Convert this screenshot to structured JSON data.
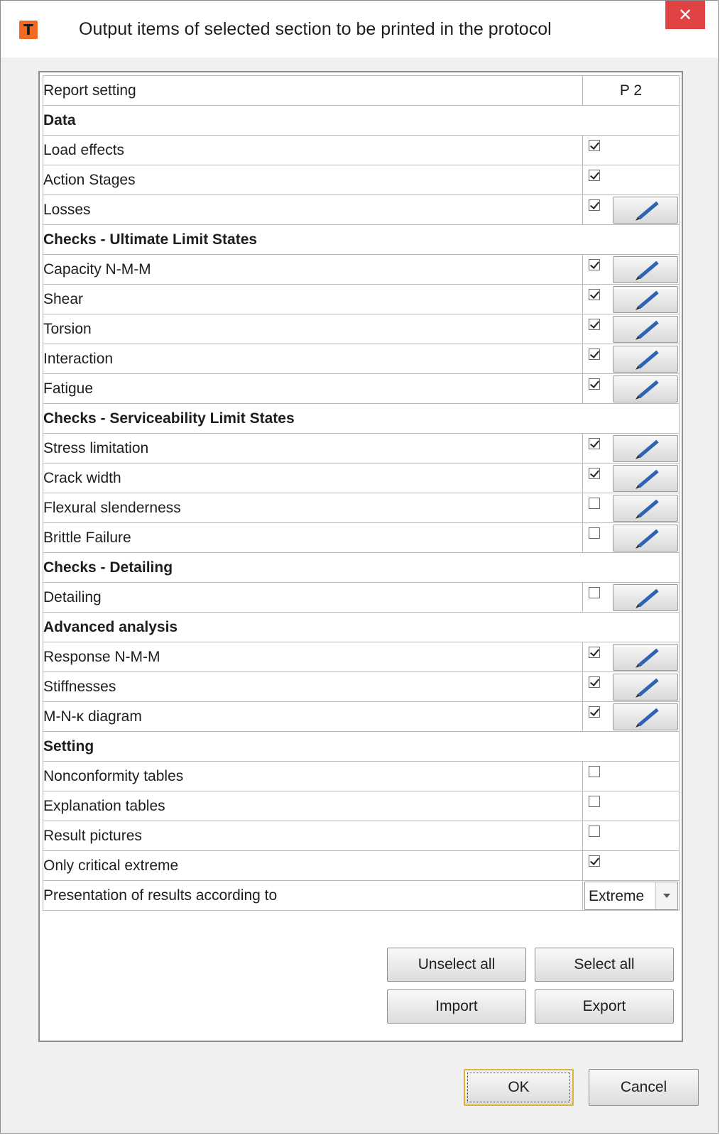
{
  "window": {
    "icon_letter": "T",
    "title": "Output items of selected section to be printed in the protocol",
    "close_symbol": "✕",
    "colors": {
      "icon_bg": "#f26a21",
      "close_bg": "#e04343",
      "pencil": "#2f63b4"
    }
  },
  "table": {
    "header": {
      "label": "Report setting",
      "column": "P 2"
    },
    "rows": [
      {
        "type": "section",
        "label": "Data"
      },
      {
        "type": "item",
        "label": "Load effects",
        "checked": true,
        "edit": false
      },
      {
        "type": "item",
        "label": "Action Stages",
        "checked": true,
        "edit": false
      },
      {
        "type": "item",
        "label": "Losses",
        "checked": true,
        "edit": true
      },
      {
        "type": "section",
        "label": "Checks - Ultimate Limit States"
      },
      {
        "type": "item",
        "label": "Capacity N-M-M",
        "checked": true,
        "edit": true
      },
      {
        "type": "item",
        "label": "Shear",
        "checked": true,
        "edit": true
      },
      {
        "type": "item",
        "label": "Torsion",
        "checked": true,
        "edit": true
      },
      {
        "type": "item",
        "label": "Interaction",
        "checked": true,
        "edit": true
      },
      {
        "type": "item",
        "label": "Fatigue",
        "checked": true,
        "edit": true
      },
      {
        "type": "section",
        "label": "Checks - Serviceability Limit States"
      },
      {
        "type": "item",
        "label": "Stress limitation",
        "checked": true,
        "edit": true
      },
      {
        "type": "item",
        "label": "Crack width",
        "checked": true,
        "edit": true
      },
      {
        "type": "item",
        "label": "Flexural slenderness",
        "checked": false,
        "edit": true
      },
      {
        "type": "item",
        "label": "Brittle Failure",
        "checked": false,
        "edit": true
      },
      {
        "type": "section",
        "label": "Checks - Detailing"
      },
      {
        "type": "item",
        "label": "Detailing",
        "checked": false,
        "edit": true
      },
      {
        "type": "section",
        "label": "Advanced analysis"
      },
      {
        "type": "item",
        "label": "Response N-M-M",
        "checked": true,
        "edit": true
      },
      {
        "type": "item",
        "label": "Stiffnesses",
        "checked": true,
        "edit": true
      },
      {
        "type": "item",
        "label": "M-N-κ diagram",
        "checked": true,
        "edit": true
      },
      {
        "type": "section",
        "label": "Setting"
      },
      {
        "type": "item",
        "label": "Nonconformity tables",
        "checked": false,
        "edit": false
      },
      {
        "type": "item",
        "label": "Explanation tables",
        "checked": false,
        "edit": false
      },
      {
        "type": "item",
        "label": "Result pictures",
        "checked": false,
        "edit": false
      },
      {
        "type": "item",
        "label": "Only critical extreme",
        "checked": true,
        "edit": false
      },
      {
        "type": "dropdown",
        "label": "Presentation of results according to",
        "value": "Extreme"
      }
    ]
  },
  "buttons": {
    "unselect_all": "Unselect all",
    "select_all": "Select all",
    "import": "Import",
    "export": "Export",
    "ok": "OK",
    "cancel": "Cancel"
  }
}
